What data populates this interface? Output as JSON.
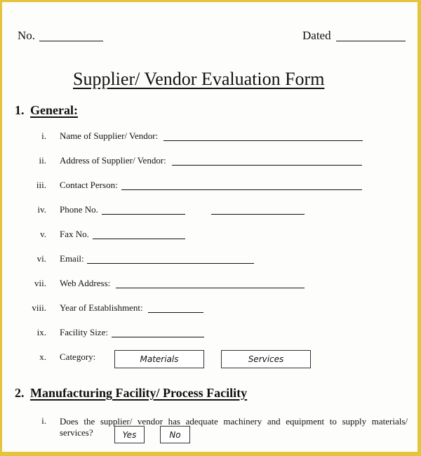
{
  "header": {
    "number_label": "No.",
    "dated_label": "Dated"
  },
  "title": "Supplier/ Vendor Evaluation Form",
  "sections": [
    {
      "number": "1.",
      "title": "General:",
      "items": [
        {
          "numeral": "i.",
          "label": "Name of Supplier/ Vendor:"
        },
        {
          "numeral": "ii.",
          "label": "Address of Supplier/ Vendor:"
        },
        {
          "numeral": "iii.",
          "label": "Contact Person:"
        },
        {
          "numeral": "iv.",
          "label": "Phone No."
        },
        {
          "numeral": "v.",
          "label": "Fax No."
        },
        {
          "numeral": "vi.",
          "label": "Email:"
        },
        {
          "numeral": "vii.",
          "label": "Web Address:"
        },
        {
          "numeral": "viii.",
          "label": "Year of Establishment:"
        },
        {
          "numeral": "ix.",
          "label": "Facility Size:"
        },
        {
          "numeral": "x.",
          "label": "Category:",
          "options": [
            "Materials",
            "Services"
          ]
        }
      ]
    },
    {
      "number": "2.",
      "title": "Manufacturing Facility/ Process Facility",
      "items": [
        {
          "numeral": "i.",
          "question_line1": "Does the supplier/ vendor has adequate machinery and equipment to supply materials/",
          "question_line2": "services?",
          "options": [
            "Yes",
            "No"
          ]
        }
      ]
    }
  ],
  "colors": {
    "border": "#e3c43a",
    "paper": "#fdfdfc",
    "ink": "#111111"
  }
}
